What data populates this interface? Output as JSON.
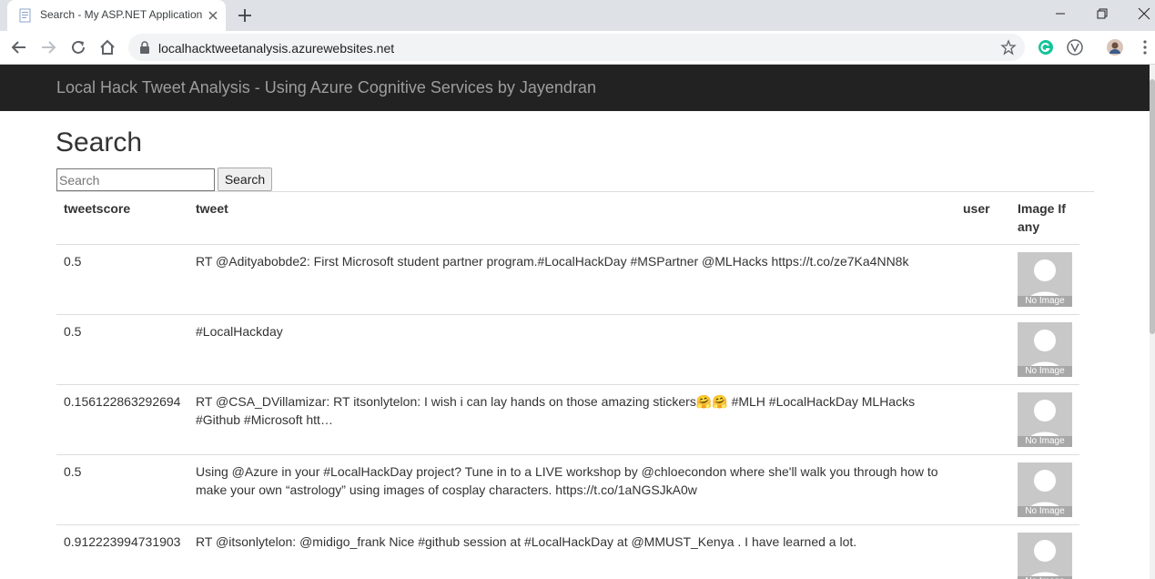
{
  "browser": {
    "tab_title": "Search - My ASP.NET Application",
    "url": "localhacktweetanalysis.azurewebsites.net"
  },
  "header": {
    "brand": "Local Hack Tweet Analysis - Using Azure Cognitive Services by Jayendran"
  },
  "main": {
    "title": "Search",
    "search": {
      "placeholder": "Search",
      "value": "",
      "button_label": "Search"
    },
    "table": {
      "headers": {
        "score": "tweetscore",
        "tweet": "tweet",
        "user": "user",
        "image": "Image If any"
      },
      "no_image_label": "No Image",
      "rows": [
        {
          "score": "0.5",
          "tweet": "RT @Adityabobde2: First Microsoft student partner program.#LocalHackDay #MSPartner @MLHacks https://t.co/ze7Ka4NN8k",
          "user": ""
        },
        {
          "score": "0.5",
          "tweet": "#LocalHackday",
          "user": ""
        },
        {
          "score": "0.156122863292694",
          "tweet": "RT @CSA_DVillamizar: RT itsonlytelon: I wish i can lay hands on those amazing stickers🤗🤗 #MLH #LocalHackDay MLHacks #Github #Microsoft htt…",
          "user": ""
        },
        {
          "score": "0.5",
          "tweet": "Using @Azure in your #LocalHackDay project? Tune in to a LIVE workshop by @chloecondon where she'll walk you through how to make your own “astrology” using images of cosplay characters. https://t.co/1aNGSJkA0w",
          "user": ""
        },
        {
          "score": "0.912223994731903",
          "tweet": "RT @itsonlytelon: @midigo_frank Nice #github session at #LocalHackDay at @MMUST_Kenya . I have learned a lot.",
          "user": ""
        }
      ]
    }
  }
}
